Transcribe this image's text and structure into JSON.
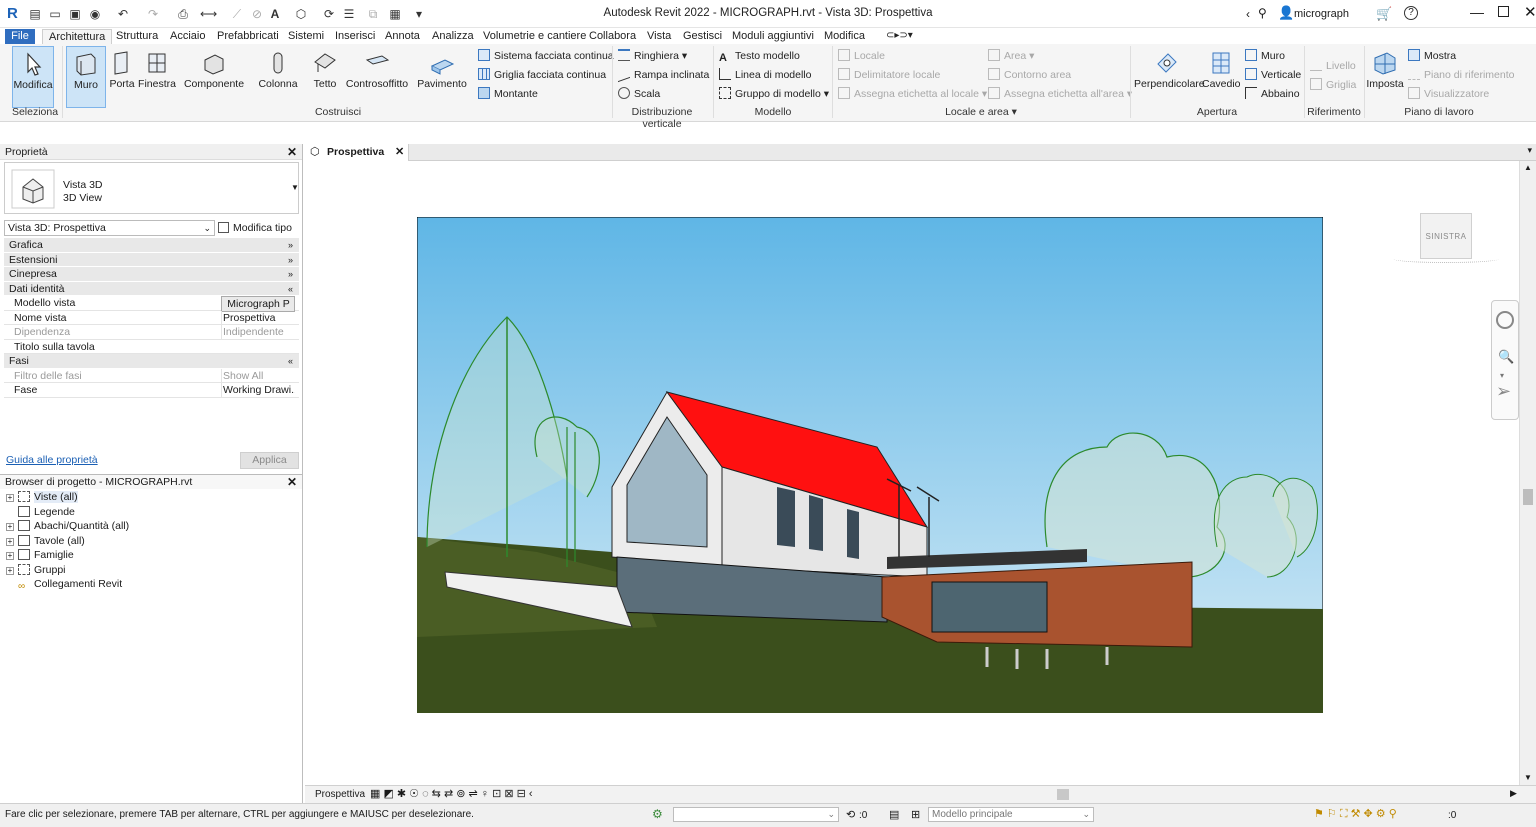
{
  "window": {
    "title": "Autodesk Revit 2022 - MICROGRAPH.rvt - Vista 3D: Prospettiva",
    "user": "micrograph",
    "help": "?"
  },
  "menu": [
    "File",
    "Architettura",
    "Struttura",
    "Acciaio",
    "Prefabbricati",
    "Sistemi",
    "Inserisci",
    "Annota",
    "Analizza",
    "Volumetrie e cantiere",
    "Collabora",
    "Vista",
    "Gestisci",
    "Moduli aggiuntivi",
    "Modifica"
  ],
  "ribbon": {
    "select": {
      "modifica": "Modifica",
      "panel": "Seleziona"
    },
    "build": {
      "muro": "Muro",
      "porta": "Porta",
      "finestra": "Finestra",
      "componente": "Componente",
      "colonna": "Colonna",
      "tetto": "Tetto",
      "controsoffitto": "Controsoffitto",
      "pavimento": "Pavimento",
      "sistema": "Sistema facciata continua",
      "griglia": "Griglia facciata continua",
      "montante": "Montante",
      "panel": "Costruisci"
    },
    "circulation": {
      "ringhiera": "Ringhiera",
      "rampa": "Rampa inclinata",
      "scala": "Scala",
      "panel": "Distribuzione verticale"
    },
    "model": {
      "testo": "Testo modello",
      "linea": "Linea di modello",
      "gruppo": "Gruppo di modello",
      "panel": "Modello"
    },
    "room": {
      "locale": "Locale",
      "delimitatore": "Delimitatore locale",
      "etichetta_locale": "Assegna etichetta al locale",
      "area": "Area",
      "contorno": "Contorno area",
      "etichetta_area": "Assegna etichetta all'area",
      "panel": "Locale e area"
    },
    "opening": {
      "perpendicolare": "Perpendicolare",
      "cavedio": "Cavedio",
      "muro": "Muro",
      "verticale": "Verticale",
      "abbaino": "Abbaino",
      "panel": "Apertura"
    },
    "datum": {
      "livello": "Livello",
      "griglia": "Griglia",
      "panel": "Riferimento"
    },
    "workplane": {
      "imposta": "Imposta",
      "mostra": "Mostra",
      "piano_rif": "Piano di riferimento",
      "visualizzatore": "Visualizzatore",
      "panel": "Piano di lavoro"
    }
  },
  "properties": {
    "title": "Proprietà",
    "type_line1": "Vista 3D",
    "type_line2": "3D View",
    "selector": "Vista 3D: Prospettiva",
    "edit_type": "Modifica tipo",
    "categories": {
      "grafica": "Grafica",
      "estensioni": "Estensioni",
      "cinepresa": "Cinepresa",
      "dati": "Dati identità",
      "fasi": "Fasi"
    },
    "rows": [
      {
        "k": "Modello vista",
        "v": "Micrograph P"
      },
      {
        "k": "Nome vista",
        "v": "Prospettiva"
      },
      {
        "k": "Dipendenza",
        "v": "Indipendente"
      },
      {
        "k": "Titolo sulla tavola",
        "v": ""
      }
    ],
    "phase_rows": [
      {
        "k": "Filtro delle fasi",
        "v": "Show All"
      },
      {
        "k": "Fase",
        "v": "Working Drawi..."
      }
    ],
    "help_link": "Guida alle proprietà",
    "apply": "Applica"
  },
  "browser": {
    "title": "Browser di progetto - MICROGRAPH.rvt",
    "items": [
      "Viste (all)",
      "Legende",
      "Abachi/Quantità (all)",
      "Tavole (all)",
      "Famiglie",
      "Gruppi",
      "Collegamenti Revit"
    ]
  },
  "view_tab": "Prospettiva",
  "viewcube": "SINISTRA",
  "viewbar_label": "Prospettiva",
  "status": {
    "hint": "Fare clic per selezionare, premere TAB per alternare, CTRL per aggiungere e MAIUSC per deselezionare.",
    "zero1": ":0",
    "model": "Modello principale",
    "zero2": ":0"
  }
}
